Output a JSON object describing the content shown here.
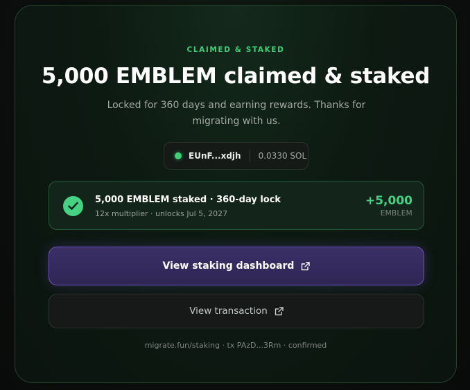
{
  "eyebrow": "CLAIMED & STAKED",
  "title": "5,000 EMBLEM claimed & staked",
  "subtitle": "Locked for 360 days and earning rewards. Thanks for migrating with us.",
  "wallet": {
    "address": "EUnF...xdjh",
    "balance": "0.0330 SOL",
    "status_color": "#3ecf78"
  },
  "stake": {
    "title": "5,000 EMBLEM staked · 360-day lock",
    "subtitle": "12x multiplier · unlocks Jul 5, 2027",
    "amount": "+5,000",
    "unit": "EMBLEM",
    "icon": "check-circle-icon"
  },
  "buttons": {
    "dashboard_label": "View staking dashboard",
    "transaction_label": "View transaction",
    "icon": "external-link-icon"
  },
  "footer": "migrate.fun/staking · tx PAzD...3Rm · confirmed",
  "colors": {
    "accent_green": "#46d282",
    "primary_button": "#3a2f66",
    "primary_border": "#6d55b8"
  }
}
